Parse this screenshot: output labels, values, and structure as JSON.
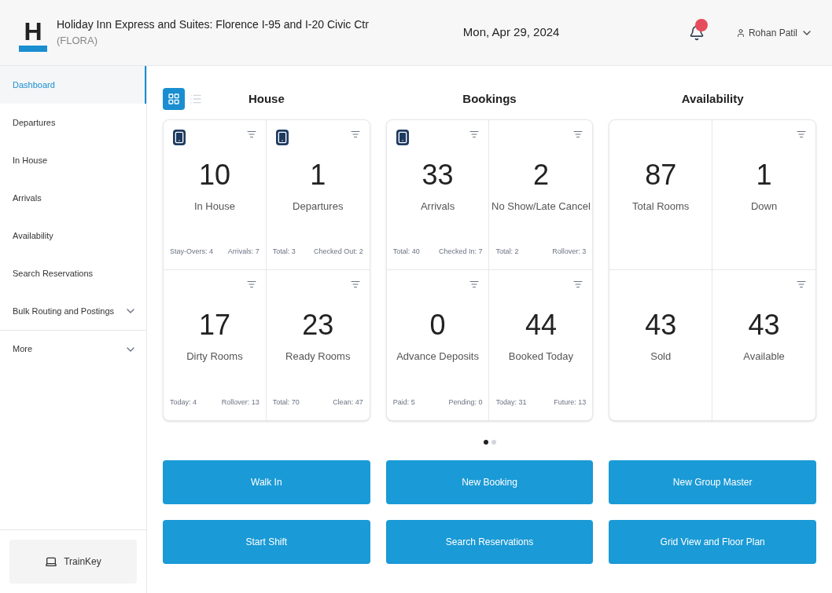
{
  "header": {
    "logo_letter": "H",
    "hotel_name": "Holiday Inn Express and Suites: Florence I-95 and I-20 Civic Ctr",
    "hotel_code": "(FLORA)",
    "date": "Mon, Apr 29, 2024",
    "user": "Rohan Patil",
    "has_notifications": true
  },
  "sidebar": {
    "items": [
      {
        "label": "Dashboard",
        "selected": true,
        "expandable": false
      },
      {
        "label": "Departures",
        "selected": false,
        "expandable": false
      },
      {
        "label": "In House",
        "selected": false,
        "expandable": false
      },
      {
        "label": "Arrivals",
        "selected": false,
        "expandable": false
      },
      {
        "label": "Availability",
        "selected": false,
        "expandable": false
      },
      {
        "label": "Search Reservations",
        "selected": false,
        "expandable": false
      },
      {
        "label": "Bulk Routing and Postings",
        "selected": false,
        "expandable": true
      },
      {
        "label": "More",
        "selected": false,
        "expandable": true
      }
    ],
    "trainkey": "TrainKey"
  },
  "view_toggle": [
    {
      "kind": "grid",
      "selected": true
    },
    {
      "kind": "list",
      "selected": false
    }
  ],
  "sections": [
    {
      "title": "House",
      "tiles": [
        {
          "value": "10",
          "label": "In House",
          "device": true,
          "sort": true,
          "left": "Stay-Overs: 4",
          "right": "Arrivals: 7"
        },
        {
          "value": "1",
          "label": "Departures",
          "device": true,
          "sort": true,
          "left": "Total: 3",
          "right": "Checked Out: 2"
        },
        {
          "value": "17",
          "label": "Dirty Rooms",
          "device": false,
          "sort": true,
          "left": "Today: 4",
          "right": "Rollover: 13"
        },
        {
          "value": "23",
          "label": "Ready Rooms",
          "device": false,
          "sort": true,
          "left": "Total: 70",
          "right": "Clean: 47"
        }
      ]
    },
    {
      "title": "Bookings",
      "tiles": [
        {
          "value": "33",
          "label": "Arrivals",
          "device": true,
          "sort": true,
          "left": "Total: 40",
          "right": "Checked In: 7"
        },
        {
          "value": "2",
          "label": "No Show/Late Cancel",
          "device": false,
          "sort": true,
          "left": "Total: 2",
          "right": "Rollover: 3"
        },
        {
          "value": "0",
          "label": "Advance Deposits",
          "device": false,
          "sort": true,
          "left": "Paid: 5",
          "right": "Pending: 0"
        },
        {
          "value": "44",
          "label": "Booked Today",
          "device": false,
          "sort": true,
          "left": "Today: 31",
          "right": "Future: 13"
        }
      ]
    },
    {
      "title": "Availability",
      "tiles": [
        {
          "value": "87",
          "label": "Total Rooms",
          "device": false,
          "sort": false
        },
        {
          "value": "1",
          "label": "Down",
          "device": false,
          "sort": true
        },
        {
          "value": "43",
          "label": "Sold",
          "device": false,
          "sort": false
        },
        {
          "value": "43",
          "label": "Available",
          "device": false,
          "sort": true
        }
      ]
    }
  ],
  "pager": [
    {
      "selected": true
    },
    {
      "selected": false
    }
  ],
  "actions": [
    "Walk In",
    "New Booking",
    "New Group Master",
    "Start Shift",
    "Search Reservations",
    "Grid View and Floor Plan"
  ]
}
